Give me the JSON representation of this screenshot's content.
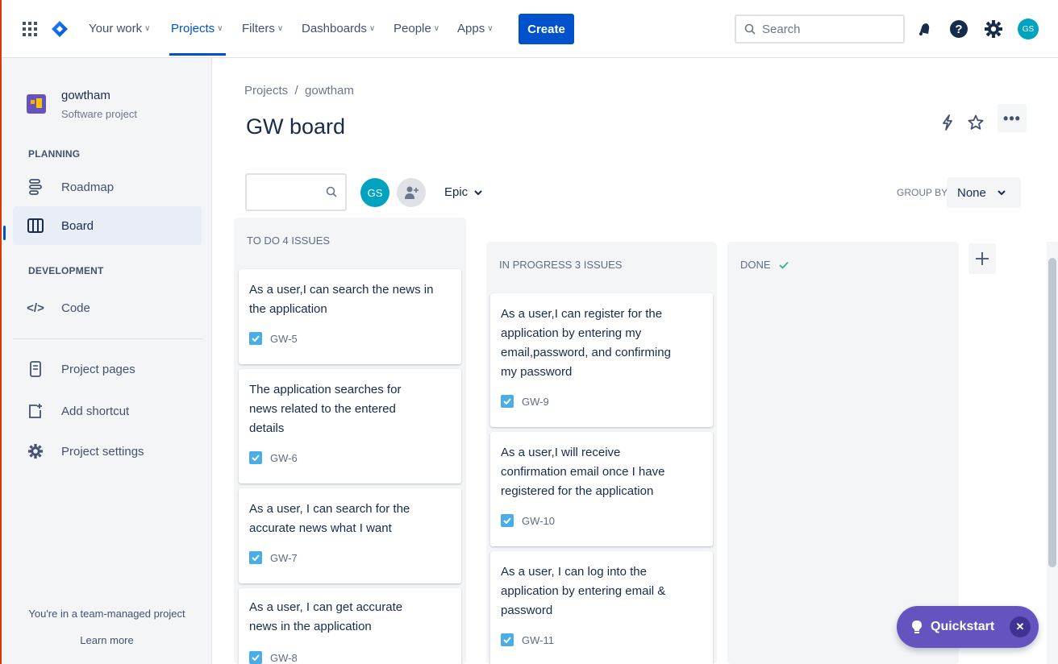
{
  "topnav": {
    "items": [
      {
        "label": "Your work"
      },
      {
        "label": "Projects"
      },
      {
        "label": "Filters"
      },
      {
        "label": "Dashboards"
      },
      {
        "label": "People"
      },
      {
        "label": "Apps"
      }
    ],
    "create_label": "Create",
    "search_placeholder": "Search",
    "avatar_initials": "GS"
  },
  "sidebar": {
    "project_name": "gowtham",
    "project_type": "Software project",
    "planning_label": "PLANNING",
    "development_label": "DEVELOPMENT",
    "items": [
      {
        "label": "Roadmap"
      },
      {
        "label": "Board"
      },
      {
        "label": "Code"
      },
      {
        "label": "Project pages"
      },
      {
        "label": "Add shortcut"
      },
      {
        "label": "Project settings"
      }
    ],
    "team_note": "You're in a team-managed project",
    "learn_more": "Learn more"
  },
  "main": {
    "breadcrumb": "Projects  /  gowtham",
    "title": "GW board",
    "filter_avatar": "GS",
    "epic_label": "Epic",
    "group_by_label": "GROUP BY",
    "group_by_value": "None"
  },
  "columns": [
    {
      "title": "TO DO 4 ISSUES",
      "cards": [
        {
          "text": "As a user,I can search the news in the application",
          "key": "GW-5"
        },
        {
          "text": "The application searches for news related to the entered details",
          "key": "GW-6"
        },
        {
          "text": "As a user, I can search for the accurate news what I want",
          "key": "GW-7"
        },
        {
          "text": "As a user, I can get accurate news in the application",
          "key": "GW-8"
        }
      ]
    },
    {
      "title": "IN PROGRESS 3 ISSUES",
      "cards": [
        {
          "text": "As a user,I can register for the application by entering my email,password, and confirming my password",
          "key": "GW-9"
        },
        {
          "text": "As a user,I will receive confirmation email once I have registered for the application",
          "key": "GW-10"
        },
        {
          "text": "As a user, I can log into the application by entering email & password",
          "key": "GW-11"
        }
      ]
    },
    {
      "title": "DONE",
      "cards": []
    }
  ],
  "quickstart": {
    "label": "Quickstart"
  },
  "colors": {
    "brand": "#0052cc",
    "quickstart": "#6554c0",
    "avatar": "#00a3bf"
  }
}
